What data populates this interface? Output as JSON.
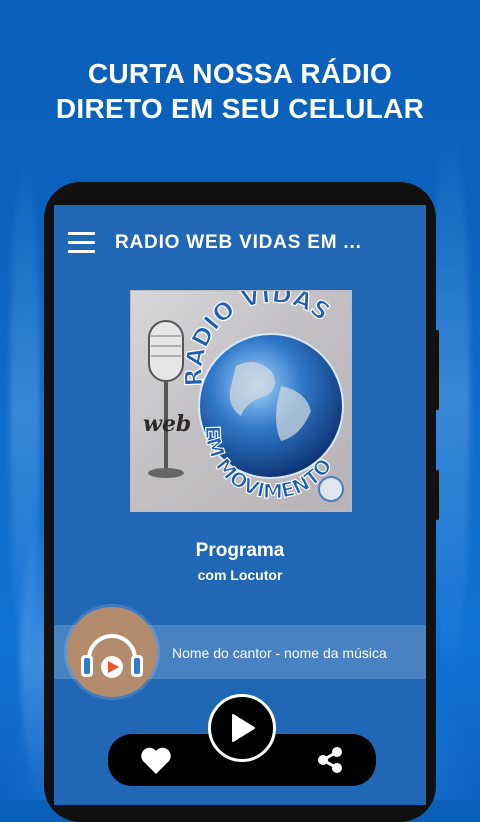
{
  "promo": {
    "line1": "CURTA NOSSA RÁDIO",
    "line2": "DIRETO EM SEU CELULAR"
  },
  "app": {
    "title": "RADIO WEB VIDAS EM ..."
  },
  "logo": {
    "arc_top": "RADIO VIDAS",
    "arc_bottom": "EM MOVIMENTO",
    "web": "web"
  },
  "program": {
    "name": "Programa",
    "host": "com Locutor"
  },
  "now_playing": {
    "text": "Nome do cantor - nome da música"
  },
  "icons": {
    "menu": "hamburger-menu-icon",
    "play": "play-icon",
    "favorite": "heart-icon",
    "share": "share-icon",
    "headphones": "headphones-icon"
  },
  "colors": {
    "background": "#0b63bd",
    "screen": "#2067b6",
    "avatar": "#b38b6d",
    "accent": "#e8562a"
  }
}
